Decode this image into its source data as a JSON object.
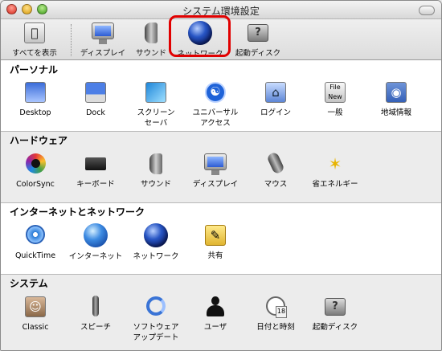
{
  "window": {
    "title": "システム環境設定"
  },
  "toolbar": {
    "items": [
      {
        "label": "すべてを表示",
        "icon": "show-all-icon"
      },
      {
        "label": "ディスプレイ",
        "icon": "display-icon"
      },
      {
        "label": "サウンド",
        "icon": "sound-icon"
      },
      {
        "label": "ネットワーク",
        "icon": "network-globe-icon"
      },
      {
        "label": "起動ディスク",
        "icon": "startup-disk-icon"
      }
    ],
    "highlighted_item": "ネットワーク",
    "highlight_color": "#e10000"
  },
  "sections": [
    {
      "title": "パーソナル",
      "items": [
        {
          "label": "Desktop",
          "icon": "desktop-icon"
        },
        {
          "label": "Dock",
          "icon": "dock-icon"
        },
        {
          "label": "スクリーンセーバ",
          "icon": "screensaver-icon"
        },
        {
          "label": "ユニバーサルアクセス",
          "icon": "universal-access-icon"
        },
        {
          "label": "ログイン",
          "icon": "login-house-icon"
        },
        {
          "label": "一般",
          "icon": "general-file-icon"
        },
        {
          "label": "地域情報",
          "icon": "international-flag-icon"
        }
      ]
    },
    {
      "title": "ハードウェア",
      "items": [
        {
          "label": "ColorSync",
          "icon": "colorsync-icon"
        },
        {
          "label": "キーボード",
          "icon": "keyboard-icon"
        },
        {
          "label": "サウンド",
          "icon": "sound-icon"
        },
        {
          "label": "ディスプレイ",
          "icon": "display-icon"
        },
        {
          "label": "マウス",
          "icon": "mouse-icon"
        },
        {
          "label": "省エネルギー",
          "icon": "energy-bulb-icon"
        }
      ]
    },
    {
      "title": "インターネットとネットワーク",
      "items": [
        {
          "label": "QuickTime",
          "icon": "quicktime-icon"
        },
        {
          "label": "インターネット",
          "icon": "internet-globe-icon"
        },
        {
          "label": "ネットワーク",
          "icon": "network-globe-icon"
        },
        {
          "label": "共有",
          "icon": "sharing-folder-icon"
        }
      ]
    },
    {
      "title": "システム",
      "items": [
        {
          "label": "Classic",
          "icon": "classic-icon"
        },
        {
          "label": "スピーチ",
          "icon": "speech-mic-icon"
        },
        {
          "label": "ソフトウェアアップデート",
          "icon": "software-update-icon"
        },
        {
          "label": "ユーザ",
          "icon": "users-silhouette-icon"
        },
        {
          "label": "日付と時刻",
          "icon": "date-time-icon"
        },
        {
          "label": "起動ディスク",
          "icon": "startup-disk-icon"
        }
      ]
    }
  ]
}
